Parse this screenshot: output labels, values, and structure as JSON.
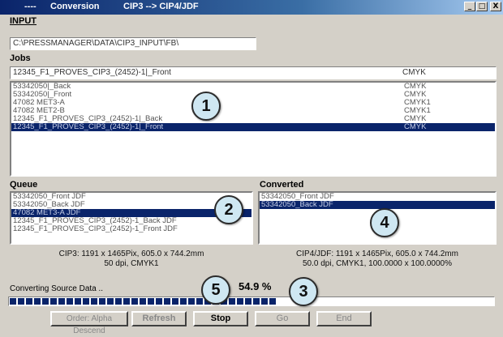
{
  "window": {
    "title_dashes": "----",
    "title_app": "Conversion",
    "title_mode": "CIP3 --> CIP4/JDF",
    "controls": [
      "_",
      "□",
      "X"
    ]
  },
  "input": {
    "label": "INPUT",
    "path": "C:\\PRESSMANAGER\\DATA\\CIP3_INPUT\\FB\\"
  },
  "jobs": {
    "label": "Jobs",
    "selected_name": "12345_F1_PROVES_CIP3_(2452)-1|_Front",
    "selected_color": "CMYK",
    "items": [
      {
        "name": "53342050|_Back",
        "color": "CMYK"
      },
      {
        "name": "53342050|_Front",
        "color": "CMYK"
      },
      {
        "name": "47082 MET3-A",
        "color": "CMYK1"
      },
      {
        "name": "47082 MET2-B",
        "color": "CMYK1"
      },
      {
        "name": "12345_F1_PROVES_CIP3_(2452)-1|_Back",
        "color": "CMYK"
      },
      {
        "name": "12345_F1_PROVES_CIP3_(2452)-1|_Front",
        "color": "CMYK"
      }
    ],
    "selected_index": 5
  },
  "queue": {
    "label": "Queue",
    "items": [
      "53342050_Front JDF",
      "53342050_Back JDF",
      "47082 MET3-A JDF",
      "12345_F1_PROVES_CIP3_(2452)-1_Back JDF",
      "12345_F1_PROVES_CIP3_(2452)-1_Front JDF"
    ],
    "selected_index": 2,
    "info_line1": "CIP3: 1191 x 1465Pix, 605.0 x 744.2mm",
    "info_line2": "50 dpi, CMYK1"
  },
  "converted": {
    "label": "Converted",
    "items": [
      "53342050_Front JDF",
      "53342050_Back JDF"
    ],
    "selected_index": 1,
    "info_line1": "CIP4/JDF: 1191 x 1465Pix, 605.0 x 744.2mm",
    "info_line2": "50.0 dpi, CMYK1, 100.0000 x 100.0000%"
  },
  "status": {
    "text": "Converting Source Data ..",
    "percent_label": "54.9 %",
    "progress_fraction": 0.549
  },
  "buttons": {
    "order": "Order: Alpha Descend",
    "refresh": "Refresh",
    "stop": "Stop",
    "go": "Go",
    "end": "End"
  },
  "callouts": [
    "1",
    "2",
    "3",
    "4",
    "5"
  ]
}
